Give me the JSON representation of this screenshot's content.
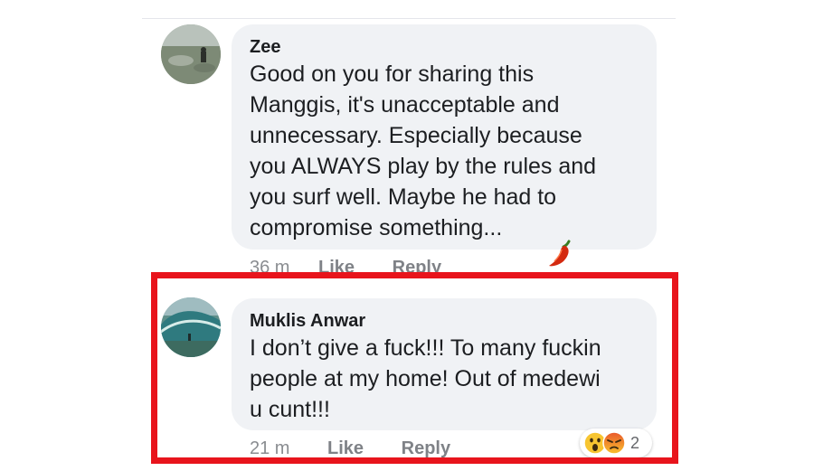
{
  "comments": [
    {
      "author": "Zee",
      "text": "Good on you for sharing this\nManggis, it's unacceptable and\nunnecessary. Especially because\nyou ALWAYS play by the rules and\nyou surf well. Maybe he had to\ncompromise something...",
      "emoji_icon": "chili-pepper-icon",
      "time": "36 m",
      "like_label": "Like",
      "reply_label": "Reply"
    },
    {
      "author": "Muklis Anwar",
      "text": "I don’t give a fuck!!! To many fuckin\npeople at my home! Out of medewi\nu cunt!!!",
      "time": "21 m",
      "like_label": "Like",
      "reply_label": "Reply",
      "reactions": {
        "icons": [
          "wow-reaction-icon",
          "angry-reaction-icon"
        ],
        "count": "2"
      }
    }
  ],
  "colors": {
    "bubble": "#f0f2f5",
    "highlight_border": "#e8141c",
    "meta_text": "#8a8d91"
  }
}
